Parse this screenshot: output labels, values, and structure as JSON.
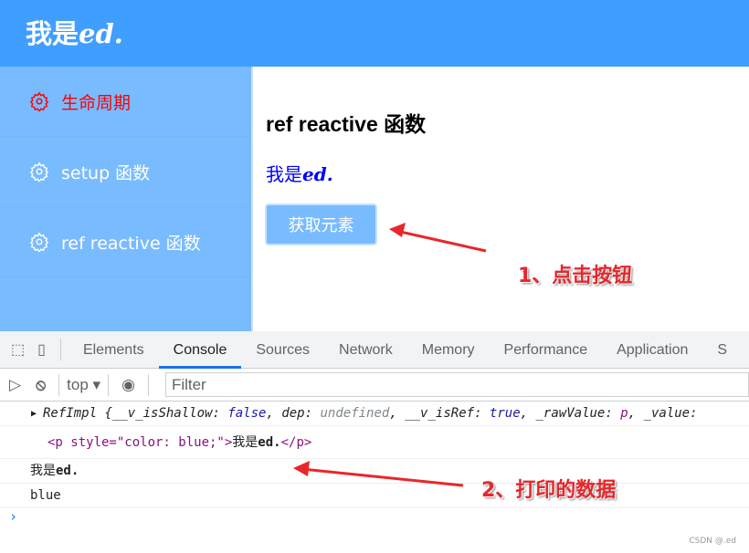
{
  "app": {
    "logo_prefix": "我是",
    "logo_suffix": "ed."
  },
  "sidebar": {
    "items": [
      {
        "label": "生命周期",
        "active": true,
        "icon": "gear-icon"
      },
      {
        "label": "setup 函数",
        "icon": "gear-icon"
      },
      {
        "label": "ref reactive 函数",
        "icon": "gear-icon"
      }
    ]
  },
  "main": {
    "title": "ref reactive 函数",
    "text_prefix": "我是",
    "text_suffix": "ed.",
    "button": "获取元素"
  },
  "annotations": {
    "step1": "1、点击按钮",
    "step2": "2、打印的数据"
  },
  "devtools": {
    "tabs": [
      "Elements",
      "Console",
      "Sources",
      "Network",
      "Memory",
      "Performance",
      "Application",
      "S"
    ],
    "active_tab": "Console",
    "context": "top",
    "filter_placeholder": "Filter",
    "console": {
      "refimpl": {
        "name": "RefImpl",
        "p1": "__v_isShallow",
        "v1": "false",
        "p2": "dep",
        "v2": "undefined",
        "p3": "__v_isRef",
        "v3": "true",
        "p4": "_rawValue",
        "v4": "p",
        "p5": "_value"
      },
      "element_html": "<p style=\"color: blue;\">",
      "element_text_prefix": "我是",
      "element_text_suffix": "ed.",
      "element_close": "</p>",
      "log1_prefix": "我是",
      "log1_suffix": "ed.",
      "log2": "blue",
      "prompt": "›"
    }
  },
  "watermark": "CSDN @.ed",
  "colors": {
    "header": "#409eff",
    "sidebar": "#79bbff",
    "active_menu": "#ff0000",
    "annotation": "#e8262b"
  }
}
